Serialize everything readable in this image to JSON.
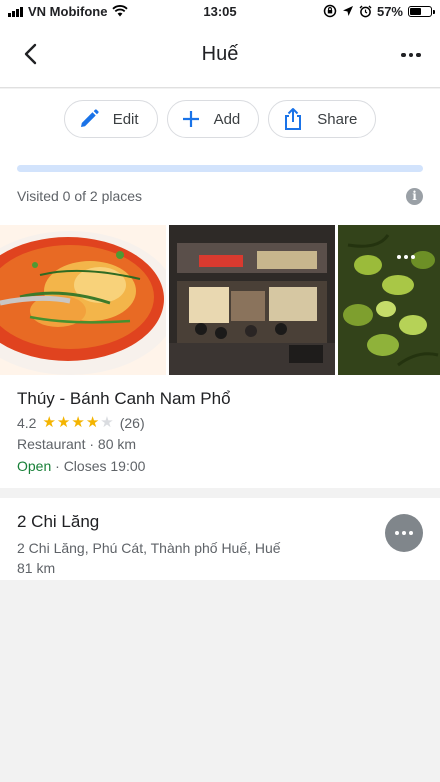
{
  "status_bar": {
    "carrier": "VN Mobifone",
    "time": "13:05",
    "battery_percent": "57%",
    "battery_level": 0.57,
    "icons": [
      "signal-icon",
      "wifi-icon",
      "rotation-lock-icon",
      "location-arrow-icon",
      "alarm-icon",
      "battery-icon"
    ]
  },
  "header": {
    "title": "Huế",
    "back_icon": "chevron-left-icon",
    "more_icon": "more-horizontal-icon"
  },
  "actions": {
    "edit_label": "Edit",
    "add_label": "Add",
    "share_label": "Share",
    "accent_color": "#1a73e8"
  },
  "progress": {
    "visited_text": "Visited 0 of 2 places",
    "fraction": 0
  },
  "photos": [
    {
      "subject": "noodle soup bowl"
    },
    {
      "subject": "restaurant storefront at night"
    },
    {
      "subject": "green chili peppers"
    }
  ],
  "places": [
    {
      "name": "Thúy - Bánh Canh Nam Phổ",
      "rating": "4.2",
      "stars_filled": 4,
      "stars_total": 5,
      "review_count": "(26)",
      "category_distance": "Restaurant · 80 km",
      "open_status": "Open",
      "closes": " · Closes 19:00"
    },
    {
      "name": "2 Chi Lăng",
      "address": "2 Chi Lăng, Phú Cát, Thành phố Huế, Huế",
      "distance": "81 km"
    }
  ]
}
